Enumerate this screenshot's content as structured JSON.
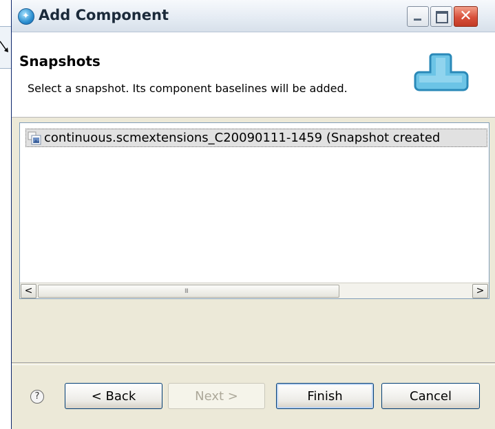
{
  "window": {
    "title": "Add Component",
    "title_icon": "wizard-icon",
    "controls": [
      "minimize-icon",
      "maximize-icon",
      "close-icon"
    ]
  },
  "header": {
    "title": "Snapshots",
    "description": "Select a snapshot.  Its component baselines will be added."
  },
  "snapshots": {
    "items": [
      {
        "label": "continuous.scmextensions_C20090111-1459 (Snapshot created",
        "icon": "snapshot-icon",
        "selected": true
      }
    ]
  },
  "scrollbar": {
    "left_arrow": "<",
    "right_arrow": ">",
    "grip": "III"
  },
  "buttons": {
    "help_glyph": "?",
    "back": "< Back",
    "next": "Next >",
    "finish": "Finish",
    "cancel": "Cancel"
  },
  "colors": {
    "dialog_bg": "#ece9d8",
    "selection_bg": "#e1e1e1",
    "close_button": "#d8503b",
    "header_graphic": "#4fb3d9"
  }
}
